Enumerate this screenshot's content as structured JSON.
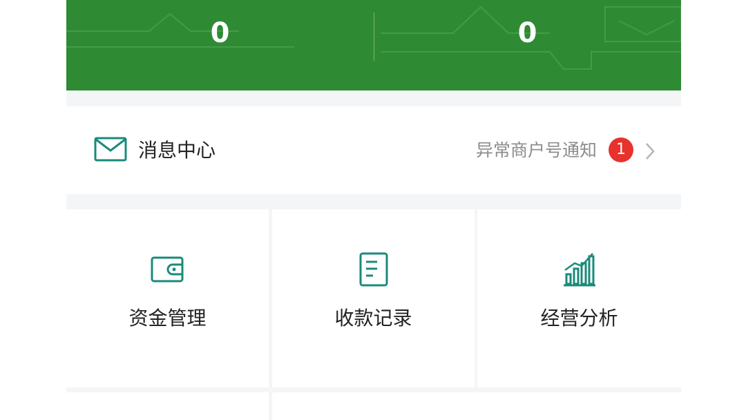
{
  "colors": {
    "header_green": "#2e8b33",
    "icon_teal": "#1a8a7a",
    "badge_red": "#e8322d"
  },
  "stats": {
    "left_value": "0",
    "right_value": "0"
  },
  "message_center": {
    "icon": "envelope-icon",
    "title": "消息中心",
    "notice": "异常商户号通知",
    "badge_count": "1",
    "chevron": "chevron-right-icon"
  },
  "grid": [
    {
      "icon": "wallet-icon",
      "label": "资金管理"
    },
    {
      "icon": "receipt-icon",
      "label": "收款记录"
    },
    {
      "icon": "bar-chart-icon",
      "label": "经营分析"
    }
  ]
}
